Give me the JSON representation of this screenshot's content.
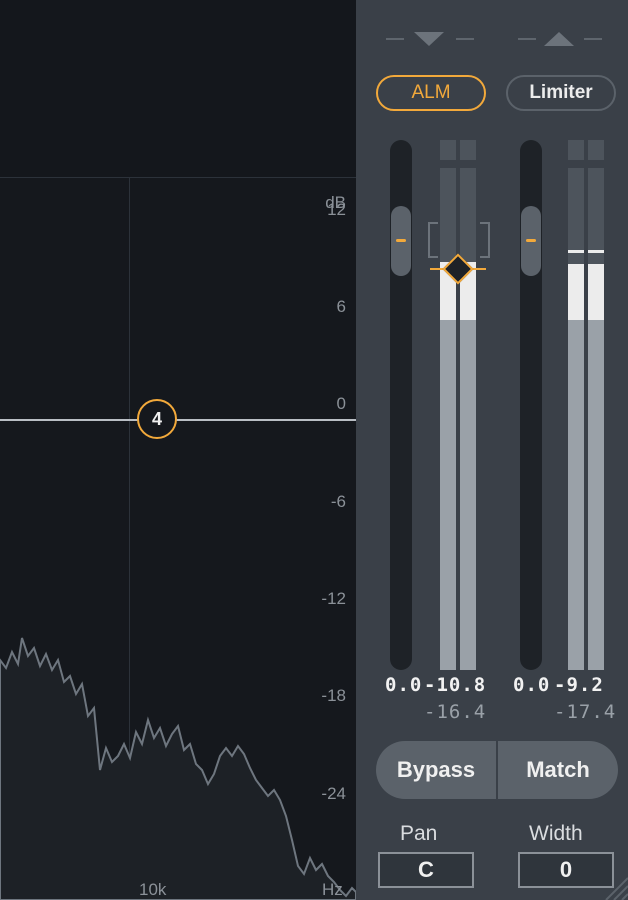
{
  "eq": {
    "db_unit": "dB",
    "db_ticks": [
      "12",
      "6",
      "0",
      "-6",
      "-12",
      "-18",
      "-24"
    ],
    "freq_label": "10k",
    "freq_unit": "Hz",
    "node_label": "4"
  },
  "panel": {
    "alm_label": "ALM",
    "limiter_label": "Limiter",
    "meters": {
      "left_fader_value": "0.0",
      "left_peak": "-10.8",
      "left_rms": "-16.4",
      "right_fader_value": "0.0",
      "right_peak": "-9.2",
      "right_rms": "-17.4"
    },
    "bypass_label": "Bypass",
    "match_label": "Match",
    "pan_label": "Pan",
    "pan_value": "C",
    "width_label": "Width",
    "width_value": "0"
  },
  "colors": {
    "accent": "#f2a93b",
    "panel_bg": "#3a4048",
    "display_bg": "#15181d"
  }
}
